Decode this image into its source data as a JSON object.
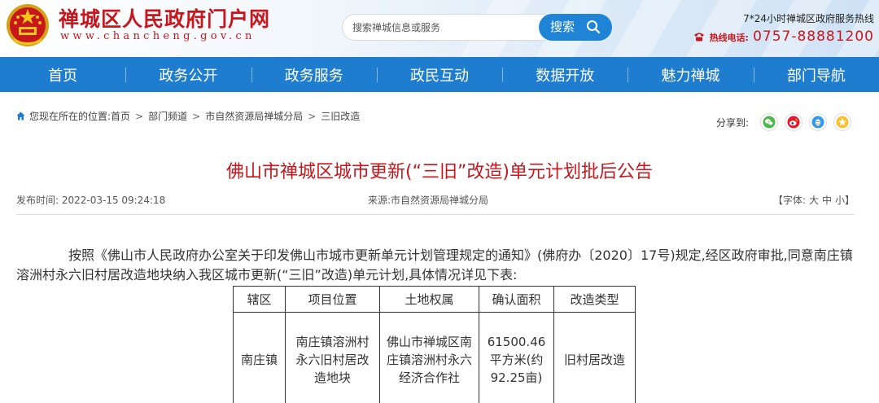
{
  "header": {
    "site_title": "禅城区人民政府门户网",
    "site_domain": "www.chancheng.gov.cn",
    "search": {
      "placeholder": "搜索禅城信息或服务",
      "button_label": "搜索"
    },
    "hotline_note": "7*24小时禅城区政府服务热线",
    "hotline_label": "热线电话:",
    "hotline_number": "0757-88881200"
  },
  "nav": {
    "items": [
      "首页",
      "政务公开",
      "政务服务",
      "政民互动",
      "数据开放",
      "魅力禅城",
      "部门导航"
    ]
  },
  "breadcrumb": {
    "prefix": "您现在所在的位置:",
    "items": [
      "首页",
      "部门频道",
      "市自然资源局禅城分局",
      "三旧改造"
    ],
    "separator": ">"
  },
  "share": {
    "label": "分享到:",
    "targets": [
      "wechat-icon",
      "weibo-icon",
      "qq-icon",
      "qzone-icon"
    ]
  },
  "article": {
    "title": "佛山市禅城区城市更新(“三旧”改造)单元计划批后公告",
    "publish_time": "发布时间: 2022-03-15 09:24:18",
    "source": "来源:市自然资源局禅城分局",
    "font_size_label_open": "【字体:",
    "font_sizes": [
      "大",
      "中",
      "小"
    ],
    "font_size_label_close": "】",
    "paragraph": "按照《佛山市人民政府办公室关于印发佛山市城市更新单元计划管理规定的通知》(佛府办〔2020〕17号)规定,经区政府审批,同意南庄镇溶洲村永六旧村居改造地块纳入我区城市更新(“三旧”改造)单元计划,具体情况详见下表:"
  },
  "table": {
    "headers": [
      "辖区",
      "项目位置",
      "土地权属",
      "确认面积",
      "改造类型"
    ],
    "rows": [
      [
        "南庄镇",
        "南庄镇溶洲村永六旧村居改造地块",
        "佛山市禅城区南庄镇溶洲村永六经济合作社",
        "61500.46平方米(约92.25亩)",
        "旧村居改造"
      ]
    ]
  },
  "colors": {
    "brand_red": "#c8161d",
    "nav_blue": "#1f7dd0",
    "search_blue": "#1f84d6"
  }
}
